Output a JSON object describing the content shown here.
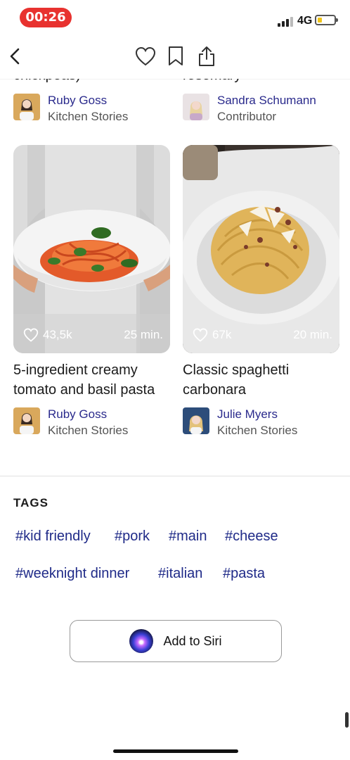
{
  "status_bar": {
    "time": "00:26",
    "network": "4G"
  },
  "nav": {
    "icons": [
      "chevron-left-icon",
      "heart-icon",
      "bookmark-icon",
      "share-icon"
    ]
  },
  "top_row": {
    "left_cut_title": "chickpeas)",
    "right_cut_title": "rosemary",
    "left_author": {
      "name": "Ruby Goss",
      "role": "Kitchen Stories"
    },
    "right_author": {
      "name": "Sandra Schumann",
      "role": "Contributor"
    }
  },
  "cards": [
    {
      "likes": "43,5k",
      "time": "25 min.",
      "title": "5-ingredient creamy tomato and basil pasta",
      "author": {
        "name": "Ruby Goss",
        "role": "Kitchen Stories"
      }
    },
    {
      "likes": "67k",
      "time": "20 min.",
      "title": "Classic spaghetti carbonara",
      "author": {
        "name": "Julie Myers",
        "role": "Kitchen Stories"
      }
    }
  ],
  "tags": {
    "heading": "TAGS",
    "items": [
      "#kid friendly",
      "#pork",
      "#main",
      "#cheese",
      "#weeknight dinner",
      "#italian",
      "#pasta"
    ]
  },
  "siri": {
    "label": "Add to Siri"
  },
  "colors": {
    "accent": "#2a2a8c",
    "tag": "#1f2a88",
    "time_pill": "#e8322f"
  }
}
